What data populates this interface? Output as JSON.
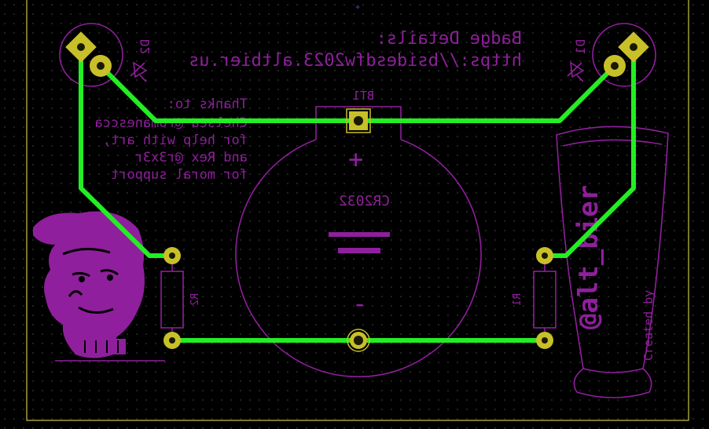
{
  "badge": {
    "title_line1": "Badge Details:",
    "title_line2": "https://bsidesdfw2023.altbier.us"
  },
  "thanks": {
    "line1": "Thanks to:",
    "line2": "Chelsea @romanescca",
    "line3": "for help with art,",
    "line4": "and Rex @r3x3r",
    "line5": "for moral support"
  },
  "labels": {
    "bt1": "BT1",
    "battery_type": "CR2032",
    "plus": "+",
    "minus": "-",
    "r1": "R1",
    "r2": "R2",
    "d1": "D1",
    "d2": "D2"
  },
  "glass": {
    "brand": "@alt_bier",
    "created_by": "Created by"
  },
  "colors": {
    "background": "#000000",
    "silkscreen": "#8f1f9c",
    "copper_trace": "#23ee23",
    "pad": "#c8c028",
    "edge_cuts": "#c8c840"
  }
}
